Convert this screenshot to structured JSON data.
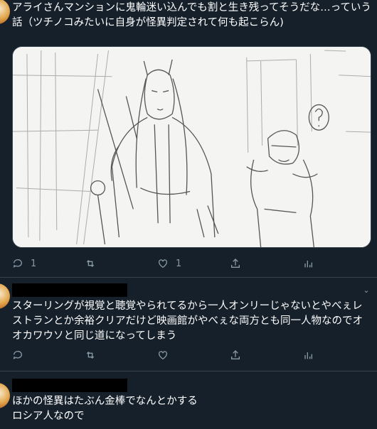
{
  "tweets": [
    {
      "text": "アライさんマンションに鬼輪迷い込んでも割と生き残ってそうだな…っていう話（ツチノコみたいに自身が怪異判定されて何も起こらん)",
      "actions": {
        "reply_count": "1",
        "retweet_count": "",
        "like_count": "1"
      },
      "has_media": true
    },
    {
      "text": "スターリングが視覚と聴覚やられてるから一人オンリーじゃないとやべぇレストランとか余裕クリアだけど映画館がやべぇな両方とも同一人物なのでオオカワウソと同じ道になってしまう",
      "actions": {
        "reply_count": "",
        "retweet_count": "",
        "like_count": ""
      }
    },
    {
      "text": "ほかの怪異はたぶん金棒でなんとかする\nロシア人なので"
    }
  ],
  "icons": {
    "reply": "reply-icon",
    "retweet": "retweet-icon",
    "like": "heart-icon",
    "share": "share-icon",
    "analytics": "analytics-icon",
    "more": "chevron-down-icon"
  },
  "colors": {
    "background": "#15202b",
    "text": "#ffffff",
    "secondary": "#8899a6",
    "divider": "#38444d"
  }
}
